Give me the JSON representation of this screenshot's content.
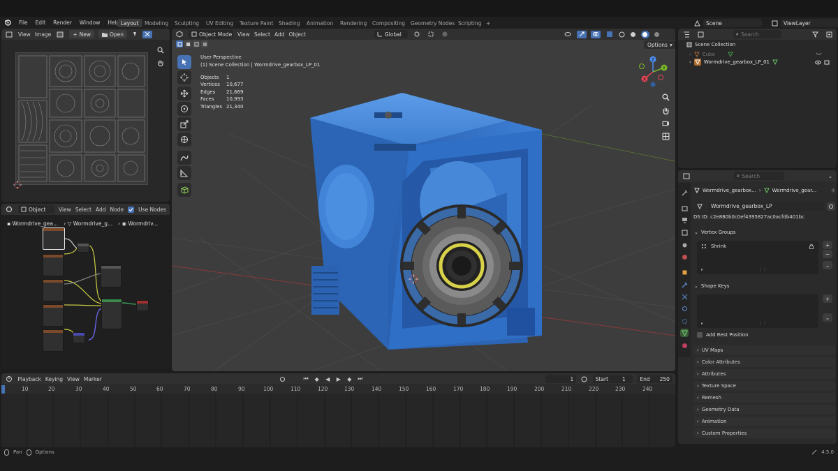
{
  "menus": [
    "File",
    "Edit",
    "Render",
    "Window",
    "Help"
  ],
  "workspaces": [
    "Layout",
    "Modeling",
    "Sculpting",
    "UV Editing",
    "Texture Paint",
    "Shading",
    "Animation",
    "Rendering",
    "Compositing",
    "Geometry Nodes",
    "Scripting",
    "+"
  ],
  "scene": {
    "label": "Scene",
    "viewlayer": "ViewLayer"
  },
  "image_editor": {
    "view": "View",
    "image": "Image",
    "new": "New",
    "open": "Open"
  },
  "node_editor": {
    "type": "Object",
    "view": "View",
    "select": "Select",
    "add": "Add",
    "node": "Node",
    "use_nodes": "Use Nodes",
    "crumb1": "Wormdrive_gea...",
    "crumb2": "Wormdrive_g...",
    "crumb3": "Wormdriv..."
  },
  "viewport": {
    "mode": "Object Mode",
    "view": "View",
    "select": "Select",
    "add": "Add",
    "object": "Object",
    "orientation": "Global",
    "options": "Options",
    "perspective": "User Perspective",
    "collection": "(1) Scene Collection | Wormdrive_gearbox_LP_01",
    "stats": [
      {
        "k": "Objects",
        "v": "1"
      },
      {
        "k": "Vertices",
        "v": "10,677"
      },
      {
        "k": "Edges",
        "v": "21,669"
      },
      {
        "k": "Faces",
        "v": "10,993"
      },
      {
        "k": "Triangles",
        "v": "21,340"
      }
    ],
    "gizmo": {
      "x": "X",
      "y": "Y",
      "z": "Z"
    }
  },
  "outliner": {
    "search": "Search",
    "root": "Scene Collection",
    "items": [
      {
        "label": "Cube",
        "dim": true
      },
      {
        "label": "Wormdrive_gearbox_LP_01",
        "dim": false
      }
    ]
  },
  "properties": {
    "search": "Search",
    "crumb1": "Wormdrive_gearbox...",
    "crumb2": "Wormdrive_gear...",
    "mesh_name": "Wormdrive_gearbox_LP",
    "ds_id": "DS ID: c2e880b0c0ef4395827ac0acfdb401bc",
    "vertex_groups": "Vertex Groups",
    "group_item": "Shrink",
    "shape_keys": "Shape Keys",
    "add_rest": "Add Rest Position",
    "sections": [
      "UV Maps",
      "Color Attributes",
      "Attributes",
      "Texture Space",
      "Remesh",
      "Geometry Data",
      "Animation",
      "Custom Properties"
    ]
  },
  "timeline": {
    "playback": "Playback",
    "keying": "Keying",
    "view": "View",
    "marker": "Marker",
    "current": "1",
    "start_label": "Start",
    "start": "1",
    "end_label": "End",
    "end": "250",
    "ticks": [
      "10",
      "20",
      "30",
      "40",
      "50",
      "60",
      "70",
      "80",
      "90",
      "100",
      "110",
      "120",
      "130",
      "140",
      "150",
      "160",
      "170",
      "180",
      "190",
      "200",
      "210",
      "220",
      "230",
      "240"
    ]
  },
  "statusbar": {
    "pan": "Pan",
    "options": "Options",
    "version": "4.5.0"
  },
  "colors": {
    "accent": "#4772b3",
    "body": "#3d7fd0",
    "object_active": "#ffa33d"
  }
}
